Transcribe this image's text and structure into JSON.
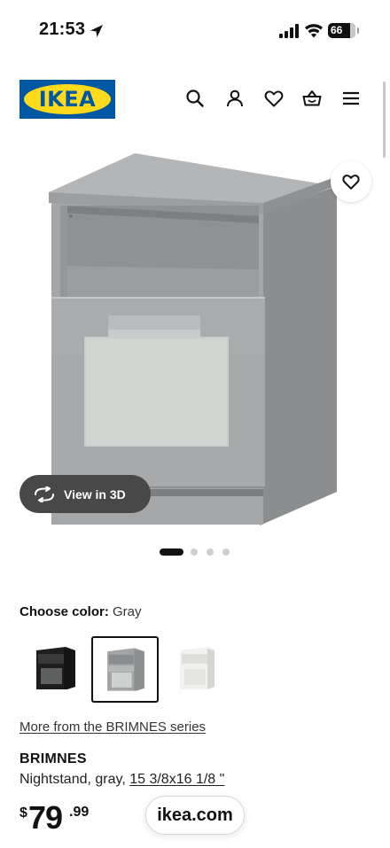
{
  "status_bar": {
    "time": "21:53",
    "battery": "66"
  },
  "header": {
    "logo_text": "IKEA",
    "icons": [
      "search-icon",
      "account-icon",
      "heart-icon",
      "shopping-basket-icon",
      "menu-icon"
    ]
  },
  "gallery": {
    "view_3d_label": "View in 3D",
    "image_count": 4,
    "active_image": 1
  },
  "color": {
    "label": "Choose color:",
    "selected": "Gray",
    "swatches": [
      {
        "name": "Black",
        "selected": false
      },
      {
        "name": "Gray",
        "selected": true
      },
      {
        "name": "White",
        "selected": false
      }
    ]
  },
  "series_link": "More from the BRIMNES series",
  "product": {
    "name": "BRIMNES",
    "description": "Nightstand, gray,",
    "dimensions": "15 3/8x16 1/8 \""
  },
  "price": {
    "currency": "$",
    "whole": "79",
    "cents": ".99"
  },
  "browser": {
    "url": "ikea.com"
  },
  "colors": {
    "ikea_blue": "#0058a3",
    "ikea_yellow": "#ffda1a",
    "product_gray": "#9a9c9d"
  }
}
